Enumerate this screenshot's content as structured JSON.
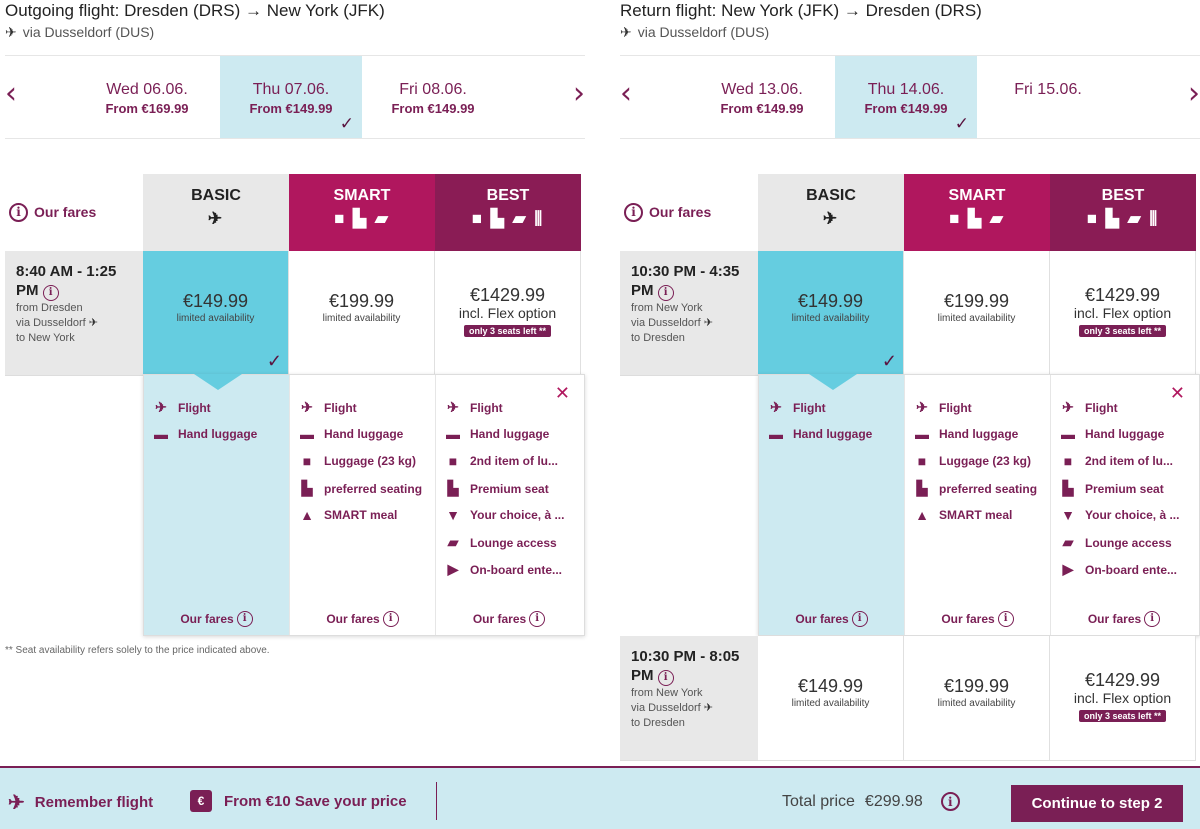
{
  "outgoing": {
    "title": "Outgoing flight: Dresden (DRS) → New York (JFK)",
    "via": "via Dusseldorf (DUS)",
    "dates": [
      {
        "day": "Wed 06.06.",
        "price": "From €169.99",
        "selected": false
      },
      {
        "day": "Thu 07.06.",
        "price": "From €149.99",
        "selected": true
      },
      {
        "day": "Fri 08.06.",
        "price": "From €149.99",
        "selected": false
      }
    ],
    "flights": [
      {
        "time": "8:40 AM - 1:25 PM",
        "from": "from Dresden",
        "via": "via Dusseldorf",
        "to": "to New York",
        "basic": "€149.99",
        "basic_note": "limited availability",
        "smart": "€199.99",
        "smart_note": "limited availability",
        "best": "€1429.99",
        "best_note": "incl. Flex option",
        "best_badge": "only 3 seats left **"
      }
    ]
  },
  "return": {
    "title": "Return flight: New York (JFK) → Dresden (DRS)",
    "via": "via Dusseldorf (DUS)",
    "dates": [
      {
        "day": "Wed 13.06.",
        "price": "From €149.99",
        "selected": false
      },
      {
        "day": "Thu 14.06.",
        "price": "From €149.99",
        "selected": true
      },
      {
        "day": "Fri 15.06.",
        "price": "",
        "selected": false
      }
    ],
    "flights": [
      {
        "time": "10:30 PM - 4:35 PM",
        "from": "from New York",
        "via": "via Dusseldorf",
        "to": "to Dresden",
        "basic": "€149.99",
        "basic_note": "limited availability",
        "smart": "€199.99",
        "smart_note": "limited availability",
        "best": "€1429.99",
        "best_note": "incl. Flex option",
        "best_badge": "only 3 seats left **"
      },
      {
        "time": "10:30 PM - 8:05 PM",
        "from": "from New York",
        "via": "via Dusseldorf",
        "to": "to Dresden",
        "basic": "€149.99",
        "basic_note": "limited availability",
        "smart": "€199.99",
        "smart_note": "limited availability",
        "best": "€1429.99",
        "best_note": "incl. Flex option",
        "best_badge": "only 3 seats left **"
      }
    ]
  },
  "fares": {
    "header": "Our fares",
    "basic": "BASIC",
    "smart": "SMART",
    "best": "BEST",
    "basic_features": [
      "Flight",
      "Hand luggage"
    ],
    "smart_features": [
      "Flight",
      "Hand luggage",
      "Luggage (23 kg)",
      "preferred seating",
      "SMART meal"
    ],
    "best_features": [
      "Flight",
      "Hand luggage",
      "2nd item of lu...",
      "Premium seat",
      "Your choice, à ...",
      "Lounge access",
      "On-board ente..."
    ],
    "our_fares": "Our fares"
  },
  "footnote": "** Seat availability refers solely to the price indicated above.",
  "bottom": {
    "remember": "Remember flight",
    "save": "From €10 Save your price",
    "total_label": "Total price",
    "total_value": "€299.98",
    "continue": "Continue to step 2"
  },
  "colors": {
    "accent": "#7a1f55",
    "smart": "#b0175e",
    "best": "#8a1c55",
    "selected": "#65cde0",
    "light": "#cdeaf1"
  }
}
